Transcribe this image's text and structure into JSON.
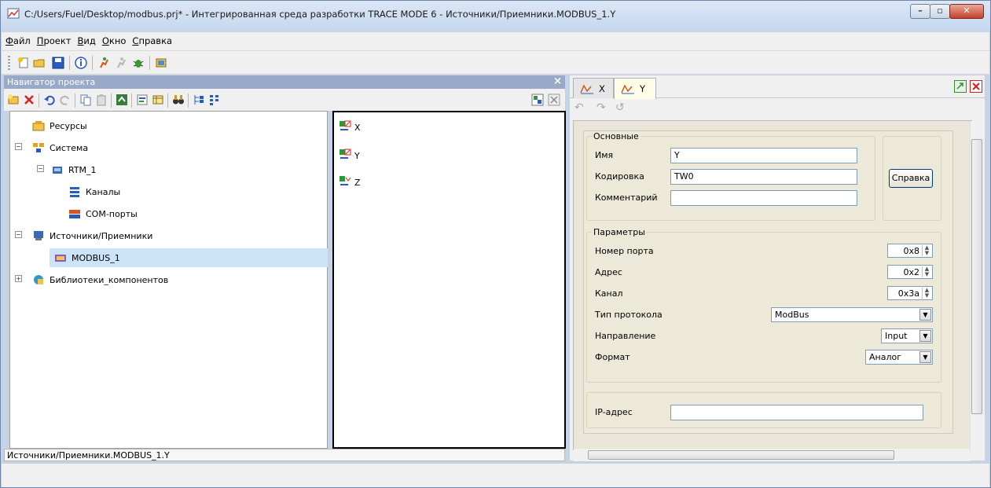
{
  "window": {
    "title": "C:/Users/Fuel/Desktop/modbus.prj* - Интегрированная среда разработки TRACE MODE 6 - Источники/Приемники.MODBUS_1.Y",
    "minimize": "–",
    "maximize": "▫",
    "close": "✕"
  },
  "menu": {
    "items": [
      {
        "u": "Ф",
        "rest": "айл"
      },
      {
        "u": "П",
        "rest": "роект"
      },
      {
        "u": "В",
        "rest": "ид"
      },
      {
        "u": "О",
        "rest": "кно"
      },
      {
        "u": "С",
        "rest": "правка"
      }
    ]
  },
  "navigator": {
    "title": "Навигатор проекта",
    "close": "×",
    "tree": [
      {
        "label": "Ресурсы"
      },
      {
        "label": "Система"
      },
      {
        "label": "RTM_1"
      },
      {
        "label": "Каналы"
      },
      {
        "label": "COM-порты"
      },
      {
        "label": "Источники/Приемники"
      },
      {
        "label": "MODBUS_1"
      },
      {
        "label": "Библиотеки_компонентов"
      }
    ],
    "list": [
      {
        "label": "X"
      },
      {
        "label": "Y"
      },
      {
        "label": "Z"
      }
    ],
    "status": "Источники/Приемники.MODBUS_1.Y"
  },
  "editor": {
    "tabs": [
      {
        "label": "X"
      },
      {
        "label": "Y"
      }
    ],
    "group_main": {
      "title": "Основные",
      "name_label": "Имя",
      "name_value": "Y",
      "encoding_label": "Кодировка",
      "encoding_value": "TW0",
      "comment_label": "Комментарий",
      "comment_value": ""
    },
    "help_button": "Справка",
    "group_params": {
      "title": "Параметры",
      "port_label": "Номер порта",
      "port_value": "0x8",
      "address_label": "Адрес",
      "address_value": "0x2",
      "channel_label": "Канал",
      "channel_value": "0x3a",
      "protocol_label": "Тип протокола",
      "protocol_value": "ModBus",
      "direction_label": "Направление",
      "direction_value": "Input",
      "format_label": "Формат",
      "format_value": "Аналог"
    },
    "ip_label": "IP-адрес",
    "ip_value": ""
  },
  "colors": {
    "navigator_header": "#98aac8",
    "selection": "#cce4f7",
    "form_bg": "#ece9d8",
    "close_red": "#c4412a"
  }
}
